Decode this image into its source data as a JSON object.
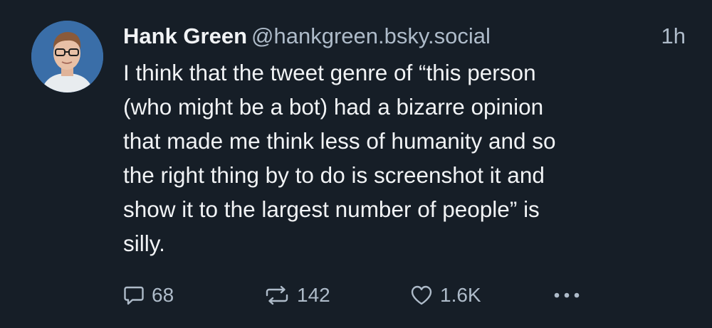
{
  "post": {
    "author": {
      "display_name": "Hank Green",
      "handle": "@hankgreen.bsky.social"
    },
    "time": "1h",
    "text": "I think that the tweet genre of “this person\n(who might be a bot) had a bizarre opinion\nthat made me think less of humanity and so\nthe right thing by to do is screenshot it and\nshow it to the largest number of people” is\nsilly.",
    "actions": {
      "reply_count": "68",
      "repost_count": "142",
      "like_count": "1.6K"
    }
  },
  "icons": {
    "reply": "speech-bubble-icon",
    "repost": "repost-arrows-icon",
    "like": "heart-outline-icon",
    "more": "ellipsis-icon"
  },
  "colors": {
    "background": "#161e27",
    "text": "#f1f3f5",
    "muted": "#aebbc9",
    "avatar_bg": "#3a6ea8"
  }
}
